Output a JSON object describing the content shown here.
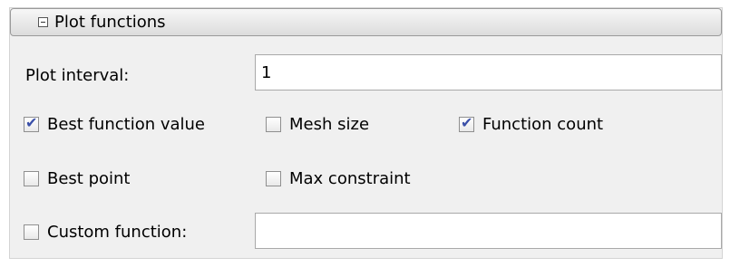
{
  "panel": {
    "title": "Plot functions",
    "collapsed": false
  },
  "plot_interval": {
    "label": "Plot interval:",
    "value": "1"
  },
  "options": {
    "best_function_value": {
      "label": "Best function value",
      "checked": true
    },
    "mesh_size": {
      "label": "Mesh size",
      "checked": false
    },
    "function_count": {
      "label": "Function count",
      "checked": true
    },
    "best_point": {
      "label": "Best point",
      "checked": false
    },
    "max_constraint": {
      "label": "Max constraint",
      "checked": false
    },
    "custom_function": {
      "label": "Custom function:",
      "checked": false,
      "value": ""
    }
  },
  "icons": {
    "collapse": "minus-box-icon",
    "check": "check-icon"
  },
  "colors": {
    "check": "#3a4fa8",
    "panel_bg": "#f0f0f0"
  }
}
